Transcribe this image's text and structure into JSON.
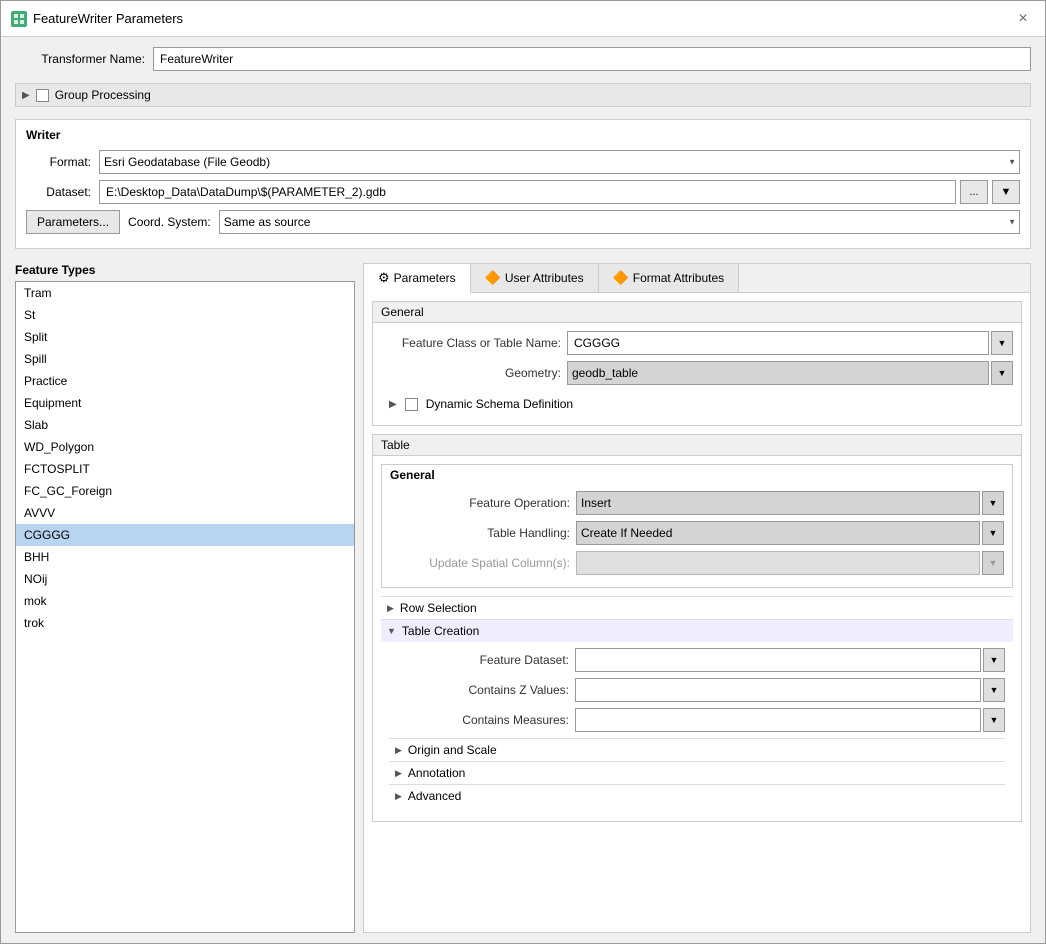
{
  "window": {
    "title": "FeatureWriter Parameters",
    "close_label": "×"
  },
  "transformer": {
    "label": "Transformer Name:",
    "value": "FeatureWriter"
  },
  "group_processing": {
    "label": "Group Processing",
    "expanded": false
  },
  "writer": {
    "title": "Writer",
    "format_label": "Format:",
    "format_value": "Esri Geodatabase (File Geodb)",
    "dataset_label": "Dataset:",
    "dataset_value": "E:\\Desktop_Data\\DataDump\\$(PARAMETER_2).gdb",
    "browse_label": "...",
    "parameters_btn": "Parameters...",
    "coord_label": "Coord. System:",
    "coord_placeholder": "Same as source"
  },
  "feature_types": {
    "label": "Feature Types",
    "items": [
      {
        "name": "Tram",
        "selected": false
      },
      {
        "name": "St",
        "selected": false
      },
      {
        "name": "Split",
        "selected": false
      },
      {
        "name": "Spill",
        "selected": false
      },
      {
        "name": "Practice",
        "selected": false
      },
      {
        "name": "Equipment",
        "selected": false
      },
      {
        "name": "Slab",
        "selected": false
      },
      {
        "name": "WD_Polygon",
        "selected": false
      },
      {
        "name": "FCTOSPLIT",
        "selected": false
      },
      {
        "name": "FC_GC_Foreign",
        "selected": false
      },
      {
        "name": "AVVV",
        "selected": false
      },
      {
        "name": "CGGGG",
        "selected": true
      },
      {
        "name": "BHH",
        "selected": false
      },
      {
        "name": "NOij",
        "selected": false
      },
      {
        "name": "mok",
        "selected": false
      },
      {
        "name": "trok",
        "selected": false
      }
    ]
  },
  "tabs": [
    {
      "id": "parameters",
      "label": "Parameters",
      "icon": "⚙",
      "active": true
    },
    {
      "id": "user-attributes",
      "label": "User Attributes",
      "icon": "🔶",
      "active": false
    },
    {
      "id": "format-attributes",
      "label": "Format Attributes",
      "icon": "🔶",
      "active": false
    }
  ],
  "general_group": {
    "title": "General",
    "feature_class_label": "Feature Class or Table Name:",
    "feature_class_value": "CGGGG",
    "geometry_label": "Geometry:",
    "geometry_value": "geodb_table",
    "dynamic_schema_label": "Dynamic Schema Definition"
  },
  "table_group": {
    "title": "Table",
    "general_sub": {
      "title": "General",
      "feature_op_label": "Feature Operation:",
      "feature_op_value": "Insert",
      "table_handling_label": "Table Handling:",
      "table_handling_value": "Create If Needed",
      "update_spatial_label": "Update Spatial Column(s):"
    },
    "row_selection": {
      "label": "Row Selection",
      "expanded": false
    },
    "table_creation": {
      "label": "Table Creation",
      "expanded": true,
      "feature_dataset_label": "Feature Dataset:",
      "feature_dataset_value": "",
      "contains_z_label": "Contains Z Values:",
      "contains_z_value": "",
      "contains_measures_label": "Contains Measures:",
      "contains_measures_value": ""
    },
    "origin_scale": {
      "label": "Origin and Scale",
      "expanded": false
    },
    "annotation": {
      "label": "Annotation",
      "expanded": false
    },
    "advanced": {
      "label": "Advanced",
      "expanded": false
    }
  }
}
